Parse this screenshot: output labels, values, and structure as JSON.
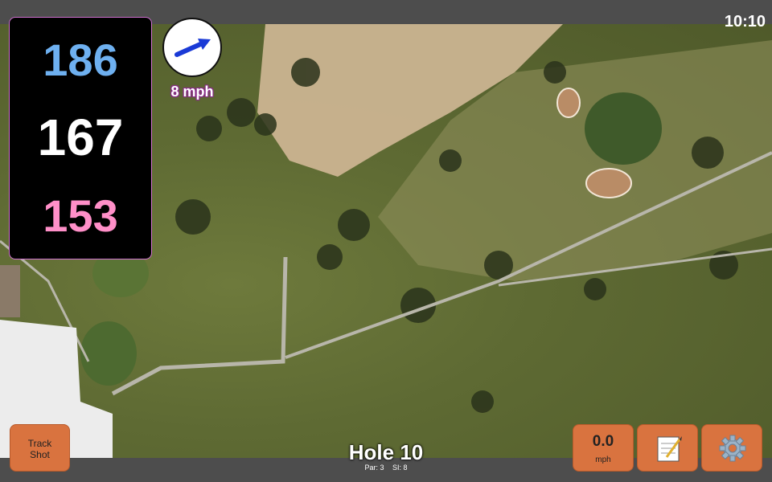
{
  "clock": "10:10",
  "yardages": {
    "back": "186",
    "middle": "167",
    "front": "153"
  },
  "wind": {
    "speed_label": "8 mph",
    "direction_icon": "wind-arrow-icon"
  },
  "buttons": {
    "track_shot_line1": "Track",
    "track_shot_line2": "Shot",
    "speed_value": "0.0",
    "speed_unit": "mph",
    "notes_icon": "notepad-icon",
    "settings_icon": "gear-icon"
  },
  "hole": {
    "title": "Hole 10",
    "par": "Par: 3",
    "si": "SI: 8"
  },
  "colors": {
    "accent_button": "#d9733f",
    "back_yard": "#6eb0f0",
    "front_yard": "#ff8fc8",
    "border": "#d070d0"
  }
}
